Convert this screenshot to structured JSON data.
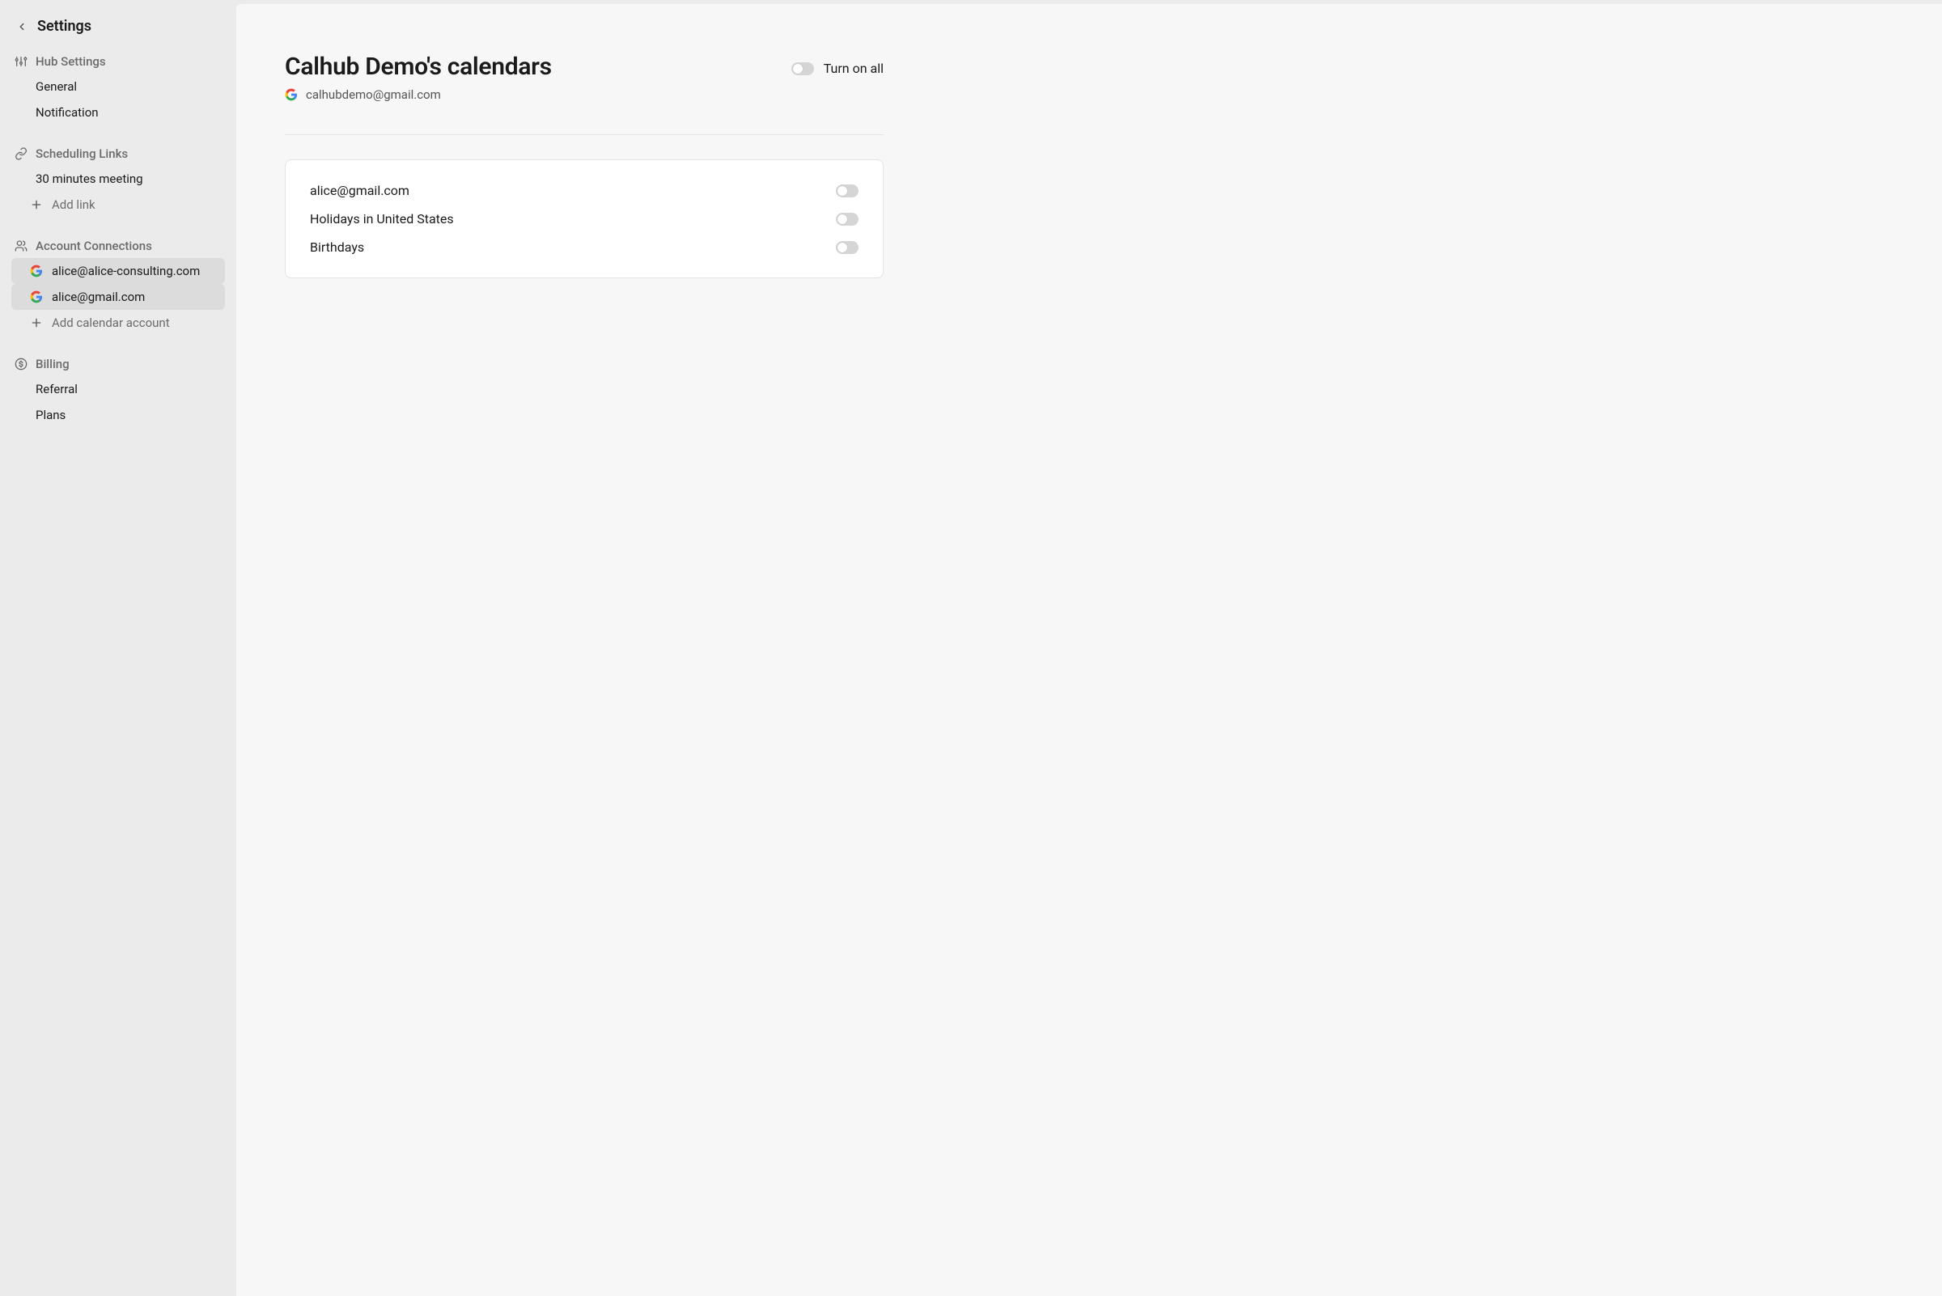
{
  "sidebar": {
    "title": "Settings",
    "sections": {
      "hub": {
        "title": "Hub Settings",
        "items": [
          {
            "label": "General"
          },
          {
            "label": "Notification"
          }
        ]
      },
      "scheduling": {
        "title": "Scheduling Links",
        "items": [
          {
            "label": "30 minutes meeting"
          }
        ],
        "add_label": "Add link"
      },
      "accounts": {
        "title": "Account Connections",
        "items": [
          {
            "label": "alice@alice-consulting.com"
          },
          {
            "label": "alice@gmail.com"
          }
        ],
        "add_label": "Add calendar account"
      },
      "billing": {
        "title": "Billing",
        "items": [
          {
            "label": "Referral"
          },
          {
            "label": "Plans"
          }
        ]
      }
    }
  },
  "main": {
    "title": "Calhub Demo's calendars",
    "account_email": "calhubdemo@gmail.com",
    "turn_on_all_label": "Turn on all",
    "calendars": [
      {
        "name": "alice@gmail.com",
        "enabled": false
      },
      {
        "name": "Holidays in United States",
        "enabled": false
      },
      {
        "name": "Birthdays",
        "enabled": false
      }
    ]
  }
}
